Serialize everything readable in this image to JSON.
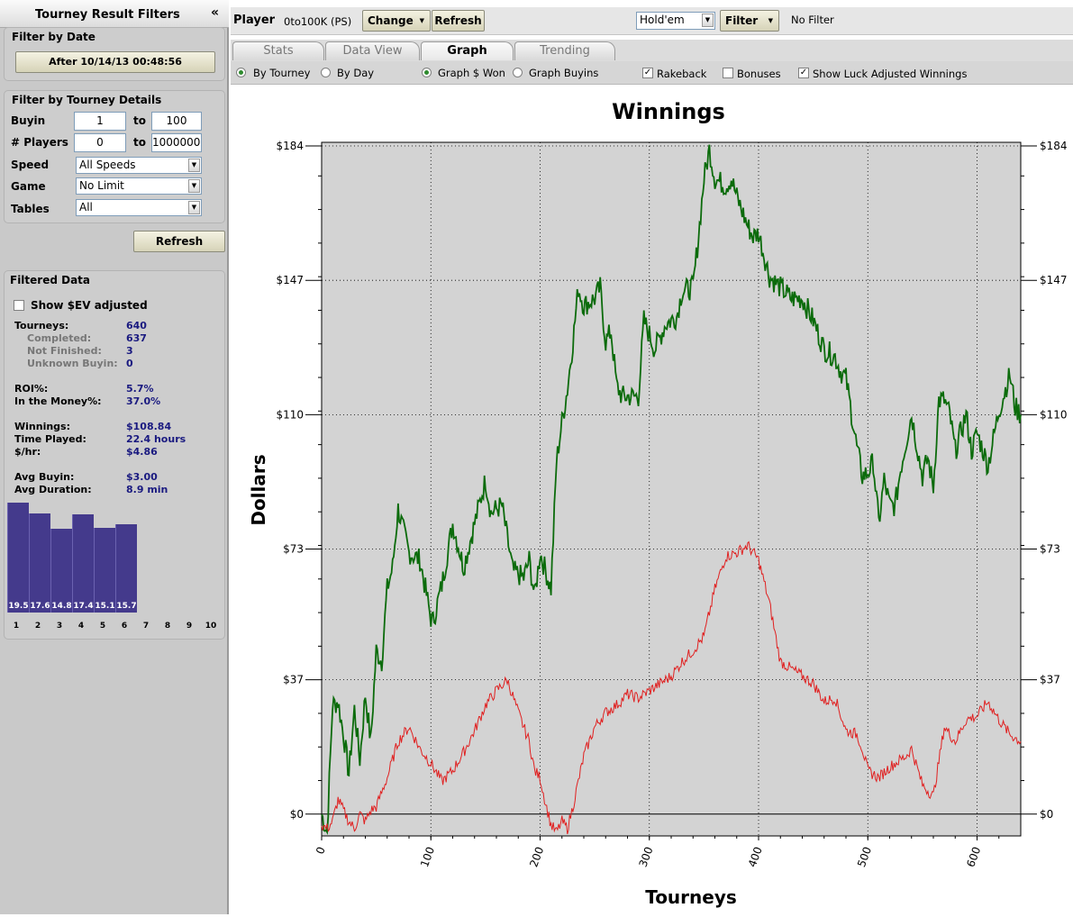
{
  "left_panel": {
    "title": "Tourney Result Filters",
    "collapse_icon": "«",
    "filter_by_date": {
      "heading": "Filter by Date",
      "button_label": "After 10/14/13 00:48:56"
    },
    "filter_by_details": {
      "heading": "Filter by Tourney Details",
      "buyin_label": "Buyin",
      "buyin_from": "1",
      "to_label": "to",
      "buyin_to": "100",
      "players_label": "# Players",
      "players_from": "0",
      "players_to": "1000000",
      "speed_label": "Speed",
      "speed_value": "All Speeds",
      "game_label": "Game",
      "game_value": "No Limit",
      "tables_label": "Tables",
      "tables_value": "All"
    },
    "refresh_label": "Refresh",
    "filtered_data": {
      "heading": "Filtered Data",
      "show_ev_label": "Show $EV adjusted",
      "tourneys_label": "Tourneys:",
      "tourneys": "640",
      "completed_label": "Completed:",
      "completed": "637",
      "not_finished_label": "Not Finished:",
      "not_finished": "3",
      "unknown_label": "Unknown Buyin:",
      "unknown": "0",
      "roi_label": "ROI%:",
      "roi": "5.7%",
      "itm_label": "In the Money%:",
      "itm": "37.0%",
      "winnings_label": "Winnings:",
      "winnings": "$108.84",
      "time_label": "Time Played:",
      "time": "22.4 hours",
      "hr_label": "$/hr:",
      "hr": "$4.86",
      "avg_buyin_label": "Avg Buyin:",
      "avg_buyin": "$3.00",
      "avg_dur_label": "Avg Duration:",
      "avg_dur": "8.9 min"
    },
    "histogram": {
      "bars": [
        "19.5",
        "17.6",
        "14.8",
        "17.4",
        "15.1",
        "15.7"
      ],
      "values": [
        19.5,
        17.6,
        14.8,
        17.4,
        15.1,
        15.7
      ],
      "axis": [
        "1",
        "2",
        "3",
        "4",
        "5",
        "6",
        "7",
        "8",
        "9",
        "10"
      ]
    }
  },
  "toolbar": {
    "player_label": "Player",
    "player_value": "0to100K (PS)",
    "change_label": "Change",
    "refresh_label": "Refresh",
    "game_select": "Hold'em",
    "filter_label": "Filter",
    "filter_status": "No Filter"
  },
  "tabs": [
    "Stats",
    "Data View",
    "Graph",
    "Trending"
  ],
  "options": {
    "by_tourney": "By Tourney",
    "by_day": "By Day",
    "graph_won": "Graph $ Won",
    "graph_buyins": "Graph Buyins",
    "rakeback": "Rakeback",
    "bonuses": "Bonuses",
    "luck": "Show Luck Adjusted Winnings"
  },
  "chart_data": {
    "type": "line",
    "title": "Winnings",
    "xlabel": "Tourneys",
    "ylabel": "Dollars",
    "xlim": [
      0,
      640
    ],
    "ylim": [
      -6,
      185
    ],
    "x_ticks": [
      0,
      100,
      200,
      300,
      400,
      500,
      600
    ],
    "y_ticks": [
      "$0",
      "$37",
      "$73",
      "$110",
      "$147",
      "$184"
    ],
    "y_tick_values": [
      0,
      37,
      73,
      110,
      147,
      184
    ],
    "grid": true,
    "series": [
      {
        "color": "#0b6b0b",
        "x": [
          0,
          5,
          10,
          15,
          20,
          25,
          30,
          35,
          40,
          45,
          50,
          55,
          60,
          65,
          70,
          75,
          80,
          90,
          100,
          102,
          110,
          120,
          130,
          140,
          150,
          155,
          165,
          175,
          185,
          190,
          195,
          200,
          210,
          215,
          220,
          225,
          230,
          235,
          240,
          250,
          255,
          260,
          265,
          270,
          275,
          280,
          290,
          295,
          300,
          305,
          315,
          325,
          330,
          340,
          345,
          350,
          355,
          360,
          370,
          375,
          380,
          390,
          395,
          400,
          410,
          420,
          430,
          440,
          445,
          450,
          460,
          470,
          475,
          480,
          490,
          495,
          500,
          505,
          510,
          515,
          520,
          525,
          530,
          540,
          550,
          555,
          560,
          565,
          570,
          575,
          580,
          590,
          595,
          600,
          610,
          620,
          630,
          635,
          640
        ],
        "y": [
          0,
          -5,
          30,
          31,
          22,
          11,
          29,
          15,
          33,
          20,
          45,
          42,
          62,
          68,
          84,
          78,
          72,
          70,
          54,
          53,
          63,
          80,
          68,
          80,
          92,
          83,
          85,
          67,
          65,
          70,
          60,
          72,
          62,
          97,
          108,
          117,
          130,
          145,
          140,
          142,
          145,
          130,
          133,
          118,
          115,
          115,
          115,
          136,
          132,
          128,
          135,
          137,
          144,
          145,
          159,
          175,
          183,
          175,
          173,
          175,
          170,
          162,
          159,
          160,
          148,
          145,
          142,
          142,
          139,
          136,
          128,
          126,
          122,
          120,
          101,
          93,
          94,
          97,
          80,
          92,
          85,
          85,
          95,
          110,
          93,
          98,
          90,
          114,
          114,
          110,
          100,
          110,
          100,
          105,
          96,
          111,
          121,
          112,
          110
        ]
      },
      {
        "color": "#e02020",
        "x": [
          0,
          5,
          10,
          15,
          20,
          25,
          30,
          35,
          40,
          45,
          50,
          60,
          70,
          80,
          90,
          100,
          110,
          120,
          130,
          140,
          150,
          160,
          170,
          180,
          190,
          195,
          200,
          205,
          210,
          215,
          220,
          225,
          230,
          240,
          250,
          260,
          270,
          280,
          290,
          300,
          310,
          320,
          330,
          340,
          350,
          360,
          370,
          380,
          390,
          400,
          405,
          410,
          420,
          430,
          440,
          450,
          460,
          470,
          480,
          490,
          495,
          500,
          510,
          520,
          530,
          535,
          540,
          550,
          560,
          570,
          580,
          590,
          600,
          610,
          620,
          630,
          640
        ],
        "y": [
          -3,
          -4,
          -2,
          4,
          1,
          -2,
          -4,
          0,
          -2,
          1,
          2,
          10,
          20,
          24,
          18,
          14,
          9,
          12,
          17,
          23,
          30,
          34,
          37,
          28,
          20,
          12,
          10,
          3,
          -3,
          -5,
          -2,
          -4,
          2,
          16,
          24,
          28,
          30,
          33,
          32,
          34,
          36,
          38,
          42,
          45,
          49,
          62,
          71,
          72,
          74,
          70,
          64,
          58,
          42,
          40,
          38,
          36,
          31,
          32,
          23,
          22,
          18,
          12,
          10,
          13,
          15,
          16,
          18,
          8,
          5,
          24,
          20,
          26,
          27,
          31,
          26,
          22,
          20
        ]
      }
    ]
  }
}
